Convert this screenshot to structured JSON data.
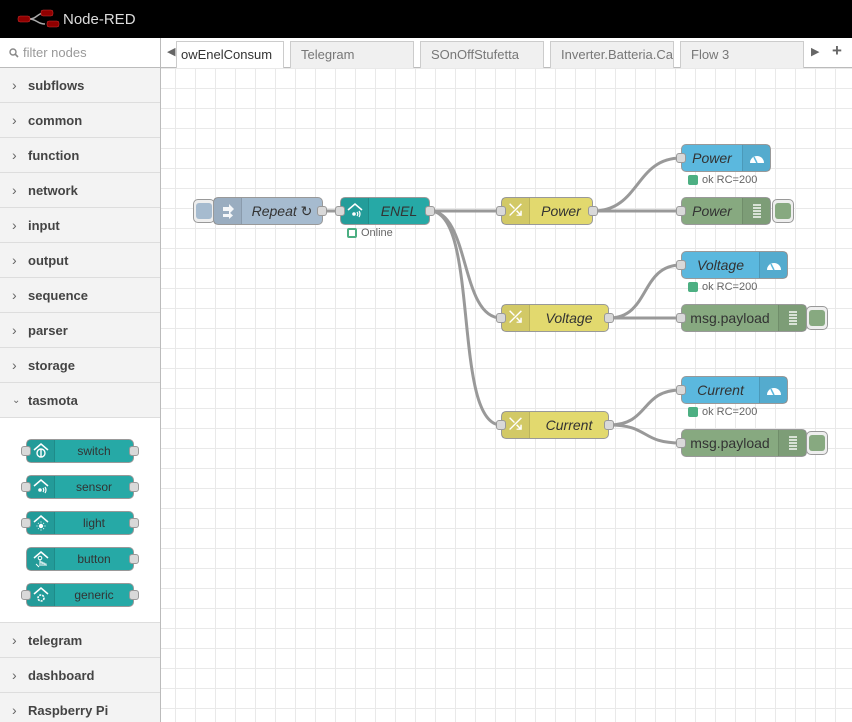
{
  "header": {
    "title": "Node-RED"
  },
  "palette": {
    "filter_placeholder": "filter nodes",
    "categories_top": [
      {
        "label": "subflows"
      },
      {
        "label": "common"
      },
      {
        "label": "function"
      },
      {
        "label": "network"
      },
      {
        "label": "input"
      },
      {
        "label": "output"
      },
      {
        "label": "sequence"
      },
      {
        "label": "parser"
      },
      {
        "label": "storage"
      }
    ],
    "expanded_category": {
      "label": "tasmota",
      "nodes": [
        {
          "label": "switch",
          "icon": "tasmota-switch-icon"
        },
        {
          "label": "sensor",
          "icon": "tasmota-sensor-icon"
        },
        {
          "label": "light",
          "icon": "tasmota-light-icon"
        },
        {
          "label": "button",
          "icon": "tasmota-button-icon"
        },
        {
          "label": "generic",
          "icon": "tasmota-generic-icon"
        }
      ]
    },
    "categories_bottom": [
      {
        "label": "telegram"
      },
      {
        "label": "dashboard"
      },
      {
        "label": "Raspberry Pi"
      }
    ]
  },
  "tabs": [
    {
      "label": "owEnelConsum",
      "active": true
    },
    {
      "label": "Telegram"
    },
    {
      "label": "SOnOffStufetta"
    },
    {
      "label": "Inverter.Batteria.Ca"
    },
    {
      "label": "Flow 3"
    }
  ],
  "flow": {
    "inject": {
      "label": "Repeat ↻"
    },
    "enel": {
      "label": "ENEL",
      "status": "Online"
    },
    "changes": [
      {
        "label": "Power"
      },
      {
        "label": "Voltage"
      },
      {
        "label": "Current"
      }
    ],
    "gauges": [
      {
        "label": "Power",
        "status": "ok RC=200"
      },
      {
        "label": "Voltage",
        "status": "ok RC=200"
      },
      {
        "label": "Current",
        "status": "ok RC=200"
      }
    ],
    "debugs": [
      {
        "label": "Power"
      },
      {
        "label": "msg.payload"
      },
      {
        "label": "msg.payload"
      }
    ]
  },
  "colors": {
    "inject": "#a6bbcf",
    "tasmota": "#26a9a6",
    "change": "#e2d96e",
    "gauge": "#5bb8de",
    "debug": "#87a980",
    "status_green": "#4caf82"
  }
}
